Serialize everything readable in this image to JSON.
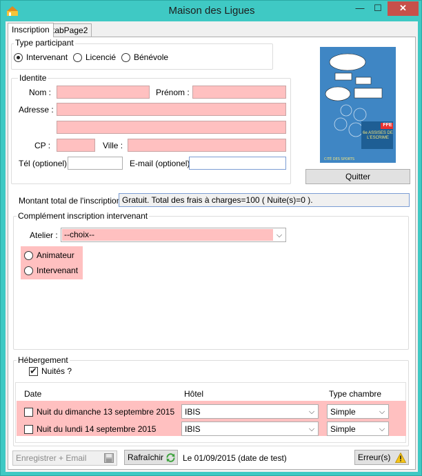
{
  "window": {
    "title": "Maison des Ligues",
    "min_glyph": "—",
    "max_glyph": "☐",
    "close_glyph": "✕"
  },
  "tabs": [
    {
      "label": "Inscription"
    },
    {
      "label": "tabPage2"
    }
  ],
  "type_participant": {
    "legend": "Type participant",
    "options": [
      "Intervenant",
      "Licencié",
      "Bénévole"
    ],
    "selected": "Intervenant"
  },
  "identite": {
    "legend": "Identite",
    "nom_label": "Nom :",
    "prenom_label": "Prénom :",
    "adresse_label": "Adresse :",
    "cp_label": "CP :",
    "ville_label": "Ville :",
    "tel_label": "Tél (optionel) :",
    "email_label": "E-mail (optionel) :"
  },
  "poster": {
    "logo_text": "FFE",
    "subtitle": "6e ASSISES DE L'ESCRIME"
  },
  "quitter_label": "Quitter",
  "montant": {
    "label": "Montant total de l'inscription :",
    "value": "Gratuit. Total des frais à charges=100 ( Nuite(s)=0 )."
  },
  "complement": {
    "legend": "Complément inscription intervenant",
    "atelier_label": "Atelier :",
    "atelier_value": "--choix--",
    "roles": [
      "Animateur",
      "Intervenant"
    ]
  },
  "hebergement": {
    "legend": "Hébergement",
    "nuites_label": "Nuités ?",
    "columns": [
      "Date",
      "Hôtel",
      "Type chambre"
    ],
    "rows": [
      {
        "date": "Nuit du dimanche 13 septembre 2015",
        "hotel": "IBIS",
        "chambre": "Simple"
      },
      {
        "date": "Nuit du lundi 14 septembre 2015",
        "hotel": "IBIS",
        "chambre": "Simple"
      }
    ]
  },
  "footer": {
    "enregistrer_label": "Enregistrer + Email",
    "rafraichir_label": "Rafraîchir",
    "date_text": "Le 01/09/2015 (date de test)",
    "erreurs_label": "Erreur(s)"
  },
  "colors": {
    "error_bg": "#ffc0c0",
    "window_frame": "#3fc9c4",
    "close_red": "#c7504a"
  }
}
